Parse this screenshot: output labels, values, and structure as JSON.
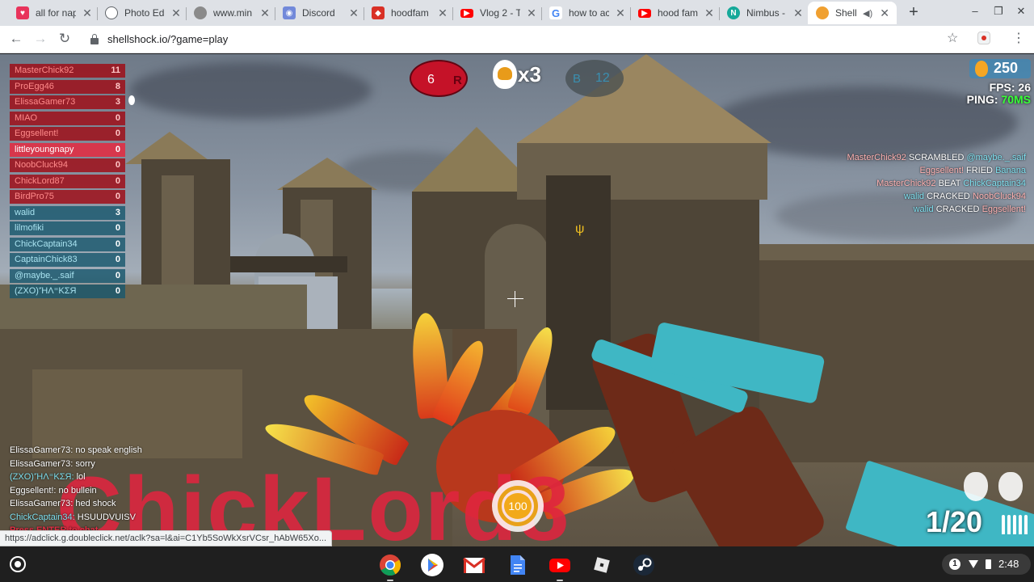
{
  "browser": {
    "tabs": [
      {
        "title": "all for nap",
        "icon": "hood-heart-icon",
        "color": "#e8335b"
      },
      {
        "title": "Photo Ed",
        "icon": "camera-aperture-icon",
        "color": "#5f6368"
      },
      {
        "title": "www.min",
        "icon": "raccoon-icon",
        "color": "#777777"
      },
      {
        "title": "Discord",
        "icon": "discord-icon",
        "color": "#7289da"
      },
      {
        "title": "hoodfam",
        "icon": "hood-red-icon",
        "color": "#d93025"
      },
      {
        "title": "Vlog 2 - T",
        "icon": "youtube-icon",
        "color": "#ff0000"
      },
      {
        "title": "how to ac",
        "icon": "google-icon",
        "color": "#4285f4"
      },
      {
        "title": "hood fam",
        "icon": "youtube-icon",
        "color": "#ff0000"
      },
      {
        "title": "Nimbus -",
        "icon": "nimbus-icon",
        "color": "#16a99a"
      },
      {
        "title": "Shell",
        "icon": "shellshock-egg-icon",
        "color": "#f0a030",
        "active": true
      }
    ],
    "url": "shellshock.io/?game=play",
    "status_url": "https://adclick.g.doubleclick.net/aclk?sa=l&ai=C1Yb5SoWkXsrVCsr_hAbW65Xo..."
  },
  "scoreboard": [
    {
      "name": "MasterChick92",
      "score": "11",
      "team": "red"
    },
    {
      "name": "ProEgg46",
      "score": "8",
      "team": "red"
    },
    {
      "name": "ElissaGamer73",
      "score": "3",
      "team": "red"
    },
    {
      "name": "MIAO",
      "score": "0",
      "team": "red"
    },
    {
      "name": "Eggsellent!",
      "score": "0",
      "team": "red"
    },
    {
      "name": "littleyoungnapy",
      "score": "0",
      "team": "me"
    },
    {
      "name": "NoobCluck94",
      "score": "0",
      "team": "red"
    },
    {
      "name": "ChickLord87",
      "score": "0",
      "team": "red"
    },
    {
      "name": "BirdPro75",
      "score": "0",
      "team": "red"
    },
    {
      "name": "walid",
      "score": "3",
      "team": "blue"
    },
    {
      "name": "lilmofiki",
      "score": "0",
      "team": "blue"
    },
    {
      "name": "ChickCaptain34",
      "score": "0",
      "team": "blue"
    },
    {
      "name": "CaptainChick83",
      "score": "0",
      "team": "blue"
    },
    {
      "name": "@maybe._.saif",
      "score": "0",
      "team": "blue"
    },
    {
      "name": "(ZXO)'ΉΛ⁼ΚΣЯ",
      "score": "0",
      "team": "blue"
    }
  ],
  "teams": {
    "red": {
      "letter": "R",
      "score": "6"
    },
    "blue": {
      "letter": "B",
      "score": "12"
    }
  },
  "streak": "x3",
  "eggs": "250",
  "fps": {
    "label": "FPS:",
    "value": "26"
  },
  "ping": {
    "label": "PING:",
    "value": "70MS"
  },
  "killfeed": [
    {
      "killer": "MasterChick92",
      "killer_team": "red",
      "verb": "SCRAMBLED",
      "victim": "@maybe._.saif",
      "victim_team": "blue"
    },
    {
      "killer": "Eggsellent!",
      "killer_team": "red",
      "verb": "FRIED",
      "victim": "Banana",
      "victim_team": "blue"
    },
    {
      "killer": "MasterChick92",
      "killer_team": "red",
      "verb": "BEAT",
      "victim": "ChickCaptain34",
      "victim_team": "blue"
    },
    {
      "killer": "walid",
      "killer_team": "blue",
      "verb": "CRACKED",
      "victim": "NoobCluck94",
      "victim_team": "red"
    },
    {
      "killer": "walid",
      "killer_team": "blue",
      "verb": "CRACKED",
      "victim": "Eggsellent!",
      "victim_team": "red"
    }
  ],
  "chat": [
    {
      "who": "ElissaGamer73:",
      "team": "red",
      "msg": "no speak english"
    },
    {
      "who": "ElissaGamer73:",
      "team": "red",
      "msg": "sorry"
    },
    {
      "who": "(ZXO)'ΉΛ⁼ΚΣЯ:",
      "team": "blue",
      "msg": "lol"
    },
    {
      "who": "Eggsellent!:",
      "team": "red",
      "msg": "no bullein"
    },
    {
      "who": "ElissaGamer73:",
      "team": "red",
      "msg": "hed shock"
    },
    {
      "who": "ChickCaptain34:",
      "team": "blue",
      "msg": "HSUUDVUISV"
    }
  ],
  "chat_prompt": "Press ENTER to chat",
  "killer_banner": "ChickLord8",
  "health": "100",
  "ammo": "1/20",
  "grenades": 2,
  "shelf": {
    "apps": [
      "chrome-icon",
      "play-store-icon",
      "gmail-icon",
      "docs-icon",
      "youtube-icon",
      "roblox-icon",
      "steam-icon"
    ],
    "notification_count": "1",
    "time": "2:48"
  }
}
